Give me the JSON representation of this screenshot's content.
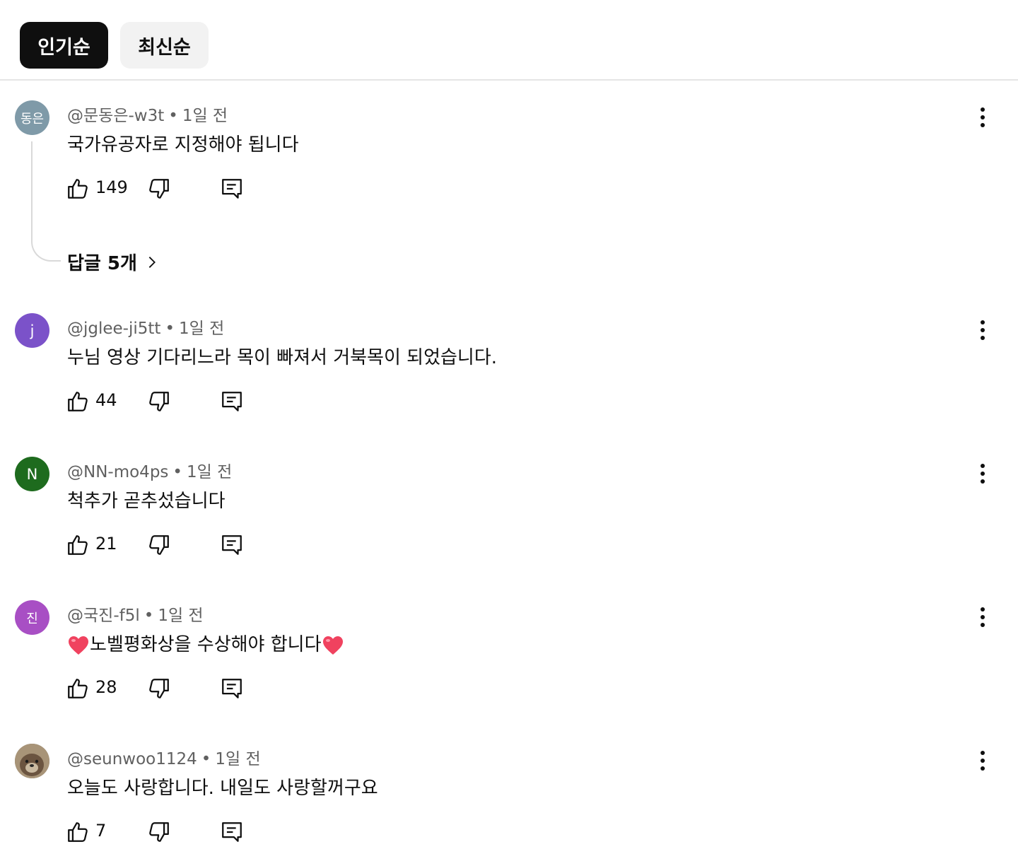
{
  "sort_chips": {
    "popular": "인기순",
    "newest": "최신순"
  },
  "comments": [
    {
      "avatar_text": "동은",
      "avatar_color": "#7f9aa8",
      "author": "@문동은-w3t",
      "time": "1일 전",
      "text": "국가유공자로 지정해야 됩니다",
      "likes": "149",
      "replies_label": "답글 5개"
    },
    {
      "avatar_text": "j",
      "avatar_color": "#7b52c9",
      "author": "@jglee-ji5tt",
      "time": "1일 전",
      "text": "누님 영상 기다리느라 목이 빠져서 거북목이 되었습니다.",
      "likes": "44"
    },
    {
      "avatar_text": "N",
      "avatar_color": "#1e6b1e",
      "author": "@NN-mo4ps",
      "time": "1일 전",
      "text": "척추가 곧추섰습니다",
      "likes": "21"
    },
    {
      "avatar_text": "진",
      "avatar_color": "#a84fc4",
      "author": "@국진-f5l",
      "time": "1일 전",
      "text_main": "노벨평화상을 수상해야 합니다",
      "likes": "28"
    },
    {
      "avatar_text": "",
      "avatar_color": "#8a7a66",
      "author": "@seunwoo1124",
      "time": "1일 전",
      "text": "오늘도 사랑합니다. 내일도 사랑할꺼구요",
      "likes": "7"
    }
  ],
  "icons": {
    "like": "thumbs-up-icon",
    "dislike": "thumbs-down-icon",
    "reply": "reply-comment-icon",
    "more": "more-vertical-icon",
    "chevron": "chevron-right-icon",
    "heart": "heart-emoji-icon"
  },
  "colors": {
    "active_chip": "#0f0f0f",
    "inactive_chip": "#f2f2f2",
    "secondary_text": "#606060",
    "heart": "#f0425f"
  }
}
